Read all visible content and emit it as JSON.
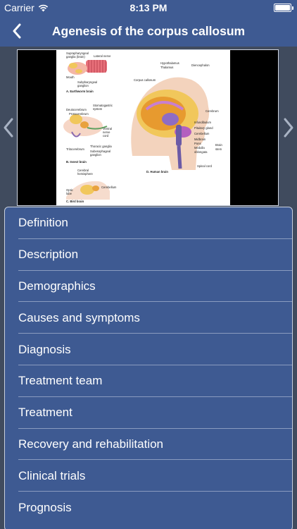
{
  "status_bar": {
    "carrier": "Carrier",
    "time": "8:13 PM",
    "wifi_icon": "wifi-icon",
    "battery_icon": "battery-icon",
    "battery_level": 1.0
  },
  "nav": {
    "title": "Agenesis of the corpus callosum",
    "back_icon": "chevron-left-icon"
  },
  "figure": {
    "labels": {
      "a1": "Suprapharyngeal",
      "a2": "ganglia (brain)",
      "a3": "Lateral nerve",
      "a4": "Mouth",
      "a5": "Subpharyngeal",
      "a6": "ganglion",
      "a_cap": "A. Earthworm brain",
      "b1": "Deutocerebrum",
      "b2": "Protocerebrum",
      "b3": "Stomatogastric",
      "b4": "system",
      "b5": "Ventral",
      "b6": "nerve",
      "b7": "cord",
      "b8": "Tritocerebrum",
      "b9": "Thoracic ganglia",
      "b10": "Subesophageal",
      "b11": "ganglion",
      "b_cap": "B. Insect brain",
      "c1": "Cerebral",
      "c2": "hemisphere",
      "c3": "Cerebellum",
      "c4": "Optic",
      "c5": "lobe",
      "c_cap": "C. Bird brain",
      "d1": "Hypothalamus",
      "d2": "Thalamus",
      "d3": "Diencephalon",
      "d4": "Corpus callosum",
      "d5": "Cerebrum",
      "d6": "Infundibulum",
      "d7": "Pituitary gland",
      "d8": "Cerebellum",
      "d9": "Midbrain",
      "d10": "Pons",
      "d11": "Medulla",
      "d12": "oblongata",
      "d13": "Brain",
      "d14": "stem",
      "d15": "Spinal cord",
      "d_cap": "D. Human brain"
    }
  },
  "carousel": {
    "prev_icon": "chevron-left-icon",
    "next_icon": "chevron-right-icon"
  },
  "menu": {
    "items": [
      {
        "label": "Definition"
      },
      {
        "label": "Description"
      },
      {
        "label": "Demographics"
      },
      {
        "label": "Causes and symptoms"
      },
      {
        "label": "Diagnosis"
      },
      {
        "label": "Treatment team"
      },
      {
        "label": "Treatment"
      },
      {
        "label": "Recovery and rehabilitation"
      },
      {
        "label": "Clinical trials"
      },
      {
        "label": "Prognosis"
      }
    ]
  },
  "colors": {
    "nav_bg": "#3e5a92",
    "page_bg": "#404b5e",
    "menu_bg": "#3e5a92",
    "separator": "#8a9bbf"
  }
}
